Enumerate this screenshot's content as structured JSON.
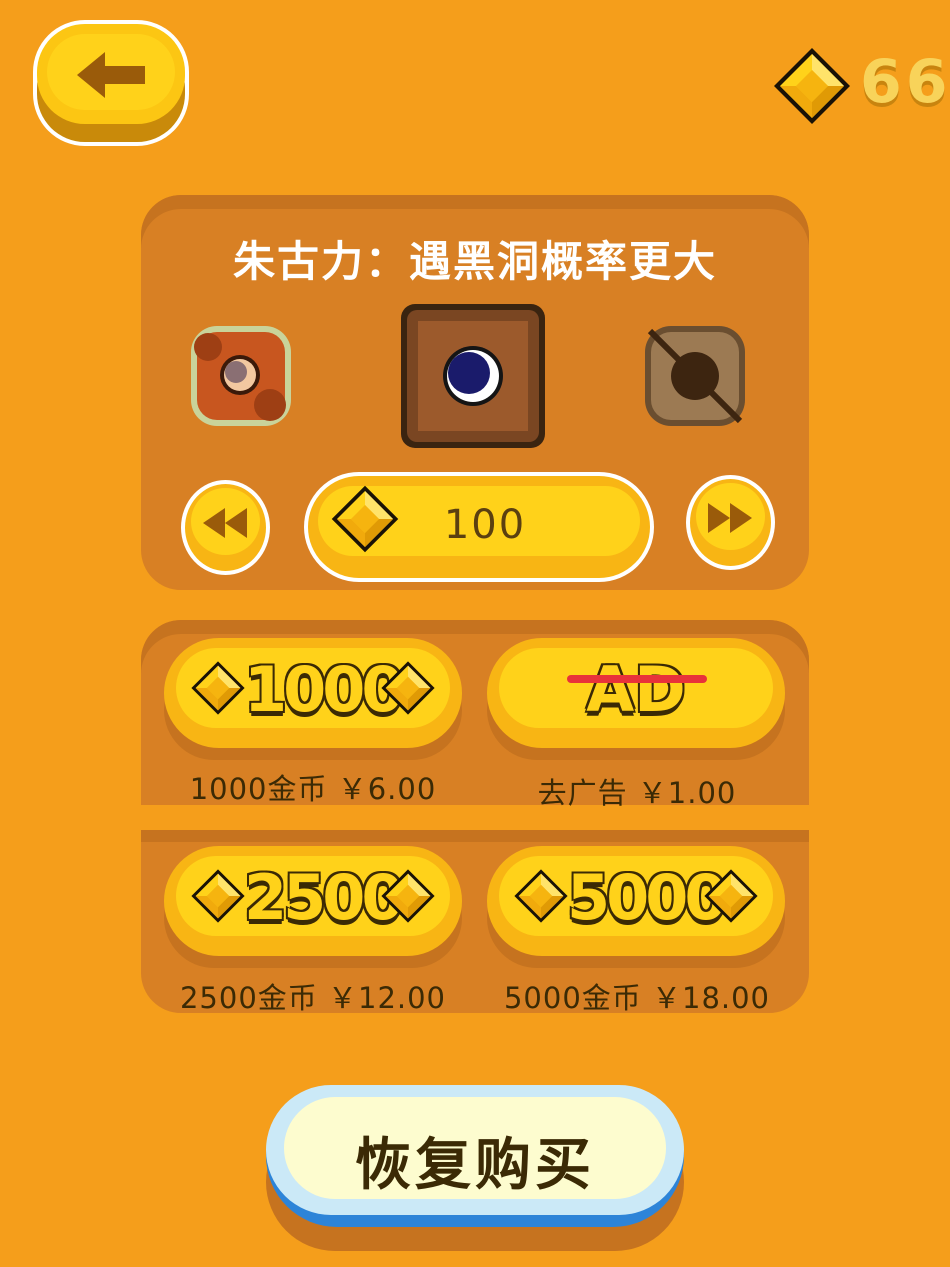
{
  "header": {
    "back_icon": "arrow-left-icon",
    "currency_icon": "gem-icon",
    "currency_value": "66"
  },
  "skin": {
    "title": "朱古力：遇黑洞概率更大",
    "items": [
      {
        "name": "skin-red",
        "state": "available"
      },
      {
        "name": "skin-brown-selected",
        "state": "selected"
      },
      {
        "name": "skin-locked",
        "state": "locked"
      }
    ],
    "prev_icon": "rewind-icon",
    "next_icon": "fast-forward-icon",
    "price_icon": "gem-icon",
    "price": "100"
  },
  "shop": {
    "items": [
      {
        "amount": "1000",
        "caption": "1000金币 ￥6.00"
      },
      {
        "amount": "AD",
        "caption": "去广告 ￥1.00"
      },
      {
        "amount": "2500",
        "caption": "2500金币 ￥12.00"
      },
      {
        "amount": "5000",
        "caption": "5000金币 ￥18.00"
      }
    ]
  },
  "restore": {
    "label": "恢复购买"
  },
  "colors": {
    "background": "#f59e1b",
    "panel": "#d88024",
    "gold": "#ffd21a",
    "restore_blue": "#2d84d8"
  }
}
